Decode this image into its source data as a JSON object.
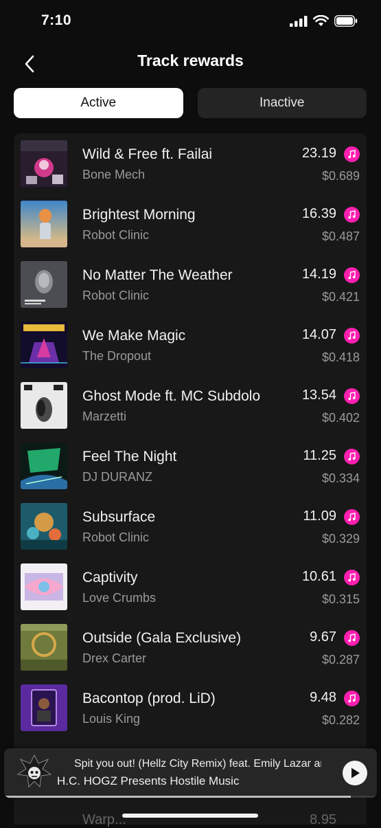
{
  "status": {
    "time": "7:10"
  },
  "header": {
    "title": "Track rewards"
  },
  "tabs": [
    {
      "label": "Active",
      "selected": true
    },
    {
      "label": "Inactive",
      "selected": false
    }
  ],
  "tracks": [
    {
      "title": "Wild & Free ft. Failai",
      "artist": "Bone Mech",
      "score": "23.19",
      "value": "$0.689"
    },
    {
      "title": "Brightest Morning",
      "artist": "Robot Clinic",
      "score": "16.39",
      "value": "$0.487"
    },
    {
      "title": "No Matter The Weather",
      "artist": "Robot Clinic",
      "score": "14.19",
      "value": "$0.421"
    },
    {
      "title": "We Make Magic",
      "artist": "The Dropout",
      "score": "14.07",
      "value": "$0.418"
    },
    {
      "title": "Ghost Mode ft. MC Subdolo",
      "artist": "Marzetti",
      "score": "13.54",
      "value": "$0.402"
    },
    {
      "title": "Feel The Night",
      "artist": "DJ DURANZ",
      "score": "11.25",
      "value": "$0.334"
    },
    {
      "title": "Subsurface",
      "artist": "Robot Clinic",
      "score": "11.09",
      "value": "$0.329"
    },
    {
      "title": "Captivity",
      "artist": "Love Crumbs",
      "score": "10.61",
      "value": "$0.315"
    },
    {
      "title": "Outside (Gala Exclusive)",
      "artist": "Drex Carter",
      "score": "9.67",
      "value": "$0.287"
    },
    {
      "title": "Bacontop (prod. LiD)",
      "artist": "Louis King",
      "score": "9.48",
      "value": "$0.282"
    }
  ],
  "peek_row": {
    "title": "Warp...",
    "score": "8.95"
  },
  "now_playing": {
    "title": "Spit you out! (Hellz City Remix) feat. Emily Lazar and",
    "artist": "H.C. HOGZ Presents Hostile Music",
    "progress": 0.93
  },
  "colors": {
    "accent": "#ff1fb0",
    "background": "#0d0d0d",
    "card": "#181818"
  },
  "icons": {
    "back": "chevron-left-icon",
    "reward": "music-note-icon",
    "play": "play-icon"
  }
}
